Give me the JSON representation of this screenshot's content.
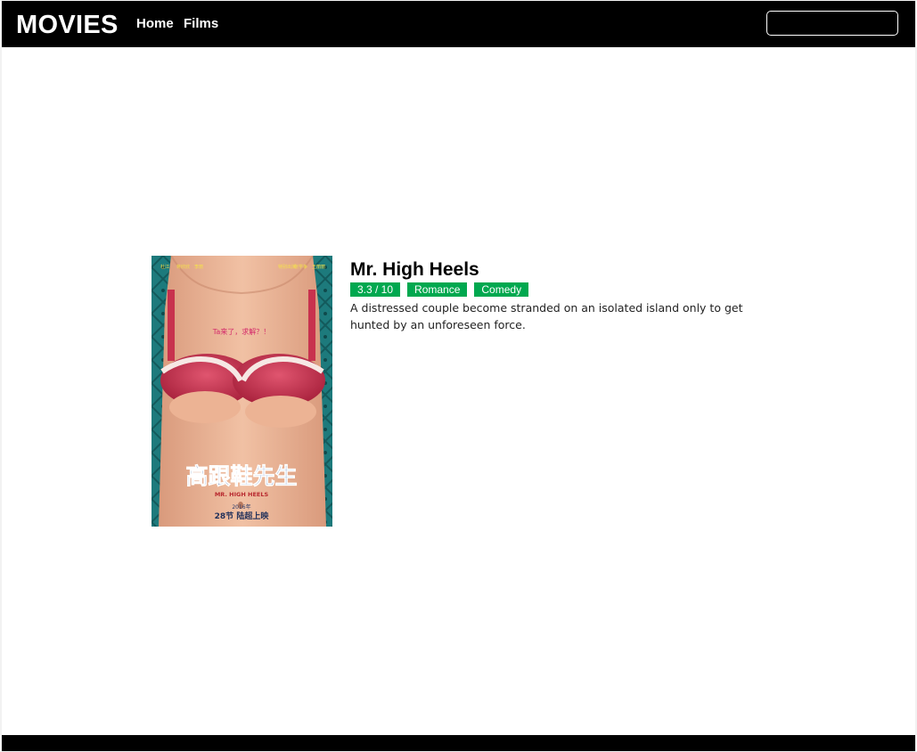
{
  "navbar": {
    "brand": "MOVIES",
    "links": [
      "Home",
      "Films"
    ],
    "search": {
      "placeholder": "",
      "value": ""
    }
  },
  "movie": {
    "title": "Mr. High Heels",
    "rating": "3.3 / 10",
    "genres": [
      "Romance",
      "Comedy"
    ],
    "description": "A distressed couple become stranded on an isolated island only to get hunted by an unforeseen force.",
    "poster": {
      "tagline": "Ta来了，求解？！",
      "title_cn": "高跟鞋先生",
      "title_en": "MR. HIGH HEELS",
      "year": "2016年",
      "release": "28节 陆超上映"
    }
  },
  "colors": {
    "navbar_bg": "#000000",
    "badge_green": "#00a84f",
    "poster_bg": "#1d7a7c",
    "bra_pink": "#c8324e"
  }
}
